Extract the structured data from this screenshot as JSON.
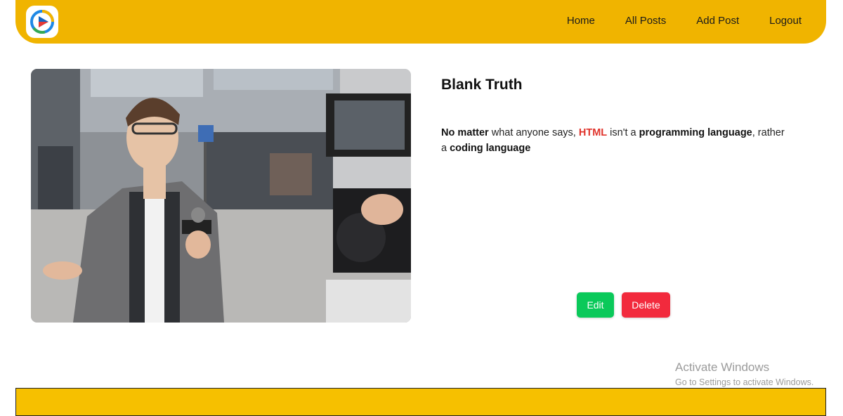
{
  "navbar": {
    "logo_icon": "play-logo-icon",
    "links": [
      "Home",
      "All Posts",
      "Add Post",
      "Logout"
    ],
    "color": "#f0b400"
  },
  "post": {
    "image_icon": "reporter-photo",
    "title": "Blank Truth",
    "body": {
      "part1_bold": "No matter",
      "part2": " what anyone says, ",
      "part3_highlight": "HTML",
      "part4": " isn't a ",
      "part5_bold": "programming language",
      "part6": ", rather a ",
      "part7_bold": "coding language"
    },
    "edit_label": "Edit",
    "delete_label": "Delete",
    "edit_color": "#0ac95a",
    "delete_color": "#f22a3d",
    "highlight_color": "#e0332b"
  },
  "watermark": {
    "title": "Activate Windows",
    "subtitle": "Go to Settings to activate Windows."
  },
  "footer": {
    "color": "#f6c000"
  }
}
